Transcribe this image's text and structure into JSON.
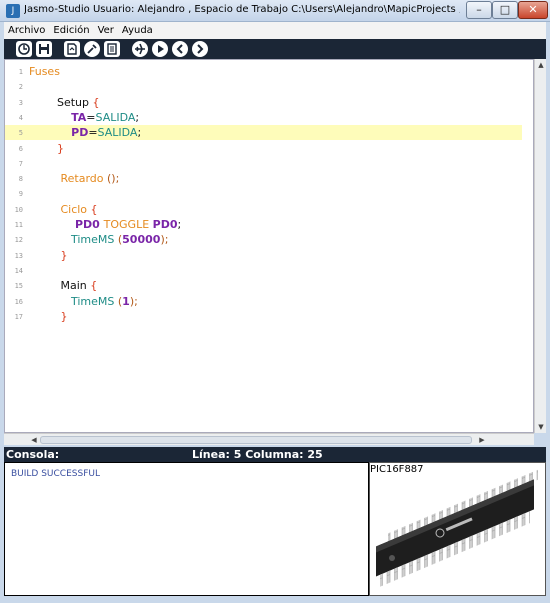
{
  "window": {
    "title": "Jasmo-Studio    Usuario: Alejandro  , Espacio de Trabajo C:\\Users\\Alejandro\\MapicProjects   , Modelo: P...",
    "buttons": {
      "minimize": "–",
      "maximize": "□",
      "close": "✕"
    }
  },
  "menu": [
    "Archivo",
    "Edición",
    "Ver",
    "Ayuda"
  ],
  "toolbar": [
    "new-icon",
    "save-icon",
    "compile-icon",
    "tools-icon",
    "document-icon",
    "plane-icon",
    "play-icon",
    "back-icon",
    "forward-icon"
  ],
  "editor": {
    "highlighted_line": 5,
    "lines": [
      {
        "n": "1",
        "tokens": [
          [
            "Fuses",
            "t-orange"
          ]
        ]
      },
      {
        "n": "2",
        "tokens": []
      },
      {
        "n": "3",
        "tokens": [
          [
            "        Setup ",
            "t-black"
          ],
          [
            "{",
            "t-red"
          ]
        ]
      },
      {
        "n": "4",
        "tokens": [
          [
            "           TA",
            "t-purple"
          ],
          [
            "=",
            "t-black"
          ],
          [
            "SALIDA",
            "t-teal"
          ],
          [
            ";",
            "t-black"
          ]
        ]
      },
      {
        "n": "5",
        "tokens": [
          [
            "           PD",
            "t-purple"
          ],
          [
            "=",
            "t-black"
          ],
          [
            "SALIDA",
            "t-teal"
          ],
          [
            ";",
            "t-black"
          ]
        ]
      },
      {
        "n": "6",
        "tokens": [
          [
            "        }",
            "t-red"
          ]
        ]
      },
      {
        "n": "7",
        "tokens": []
      },
      {
        "n": "8",
        "tokens": [
          [
            "         Retardo ",
            "t-orange"
          ],
          [
            "();",
            "t-brown"
          ]
        ]
      },
      {
        "n": "9",
        "tokens": []
      },
      {
        "n": "10",
        "tokens": [
          [
            "         Ciclo ",
            "t-orange"
          ],
          [
            "{",
            "t-red"
          ]
        ]
      },
      {
        "n": "11",
        "tokens": [
          [
            "            PD0 ",
            "t-purple"
          ],
          [
            "TOGGLE ",
            "t-orange"
          ],
          [
            "PD0",
            "t-purple"
          ],
          [
            ";",
            "t-black"
          ]
        ]
      },
      {
        "n": "12",
        "tokens": [
          [
            "            TimeMS ",
            "t-teal"
          ],
          [
            "(",
            "t-brown"
          ],
          [
            "50000",
            "t-purple"
          ],
          [
            ");",
            "t-brown"
          ]
        ]
      },
      {
        "n": "13",
        "tokens": [
          [
            "         }",
            "t-red"
          ]
        ]
      },
      {
        "n": "14",
        "tokens": []
      },
      {
        "n": "15",
        "tokens": [
          [
            "         Main ",
            "t-black"
          ],
          [
            "{",
            "t-red"
          ]
        ]
      },
      {
        "n": "16",
        "tokens": [
          [
            "            TimeMS ",
            "t-teal"
          ],
          [
            "(",
            "t-brown"
          ],
          [
            "1",
            "t-purple"
          ],
          [
            ");",
            "t-brown"
          ]
        ]
      },
      {
        "n": "17",
        "tokens": [
          [
            "         }",
            "t-red"
          ]
        ]
      }
    ]
  },
  "status": {
    "console_label": "Consola:",
    "position": "Línea: 5 Columna: 25"
  },
  "console": {
    "output": "BUILD SUCCESSFUL"
  },
  "chip": {
    "model": "PIC16F887"
  }
}
